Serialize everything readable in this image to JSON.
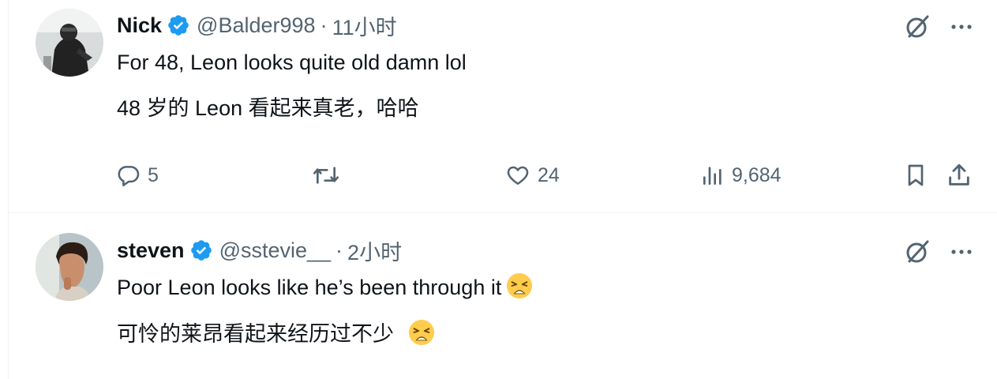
{
  "tweets": [
    {
      "name": "Nick",
      "handle": "@Balder998",
      "separator": "·",
      "time": "11小时",
      "text_en": "For 48, Leon looks quite old damn lol",
      "text_zh": "48 岁的 Leon 看起来真老，哈哈",
      "replies": "5",
      "likes": "24",
      "views": "9,684"
    },
    {
      "name": "steven",
      "handle": "@sstevie__",
      "separator": "·",
      "time": "2小时",
      "text_en": "Poor Leon looks like he’s been through it",
      "text_zh": "可怜的莱昂看起来经历过不少"
    }
  ],
  "icons": {
    "verified": "verified-badge-icon",
    "grok": "grok-icon",
    "more": "more-icon",
    "reply": "reply-icon",
    "retweet": "retweet-icon",
    "like": "like-icon",
    "views": "views-icon",
    "bookmark": "bookmark-icon",
    "share": "share-icon",
    "emoji": "weary-face-emoji"
  },
  "colors": {
    "text": "#0f1419",
    "secondary": "#536471",
    "verified": "#1d9bf0",
    "divider": "#eff3f4",
    "emoji": "#ffcc4d"
  }
}
